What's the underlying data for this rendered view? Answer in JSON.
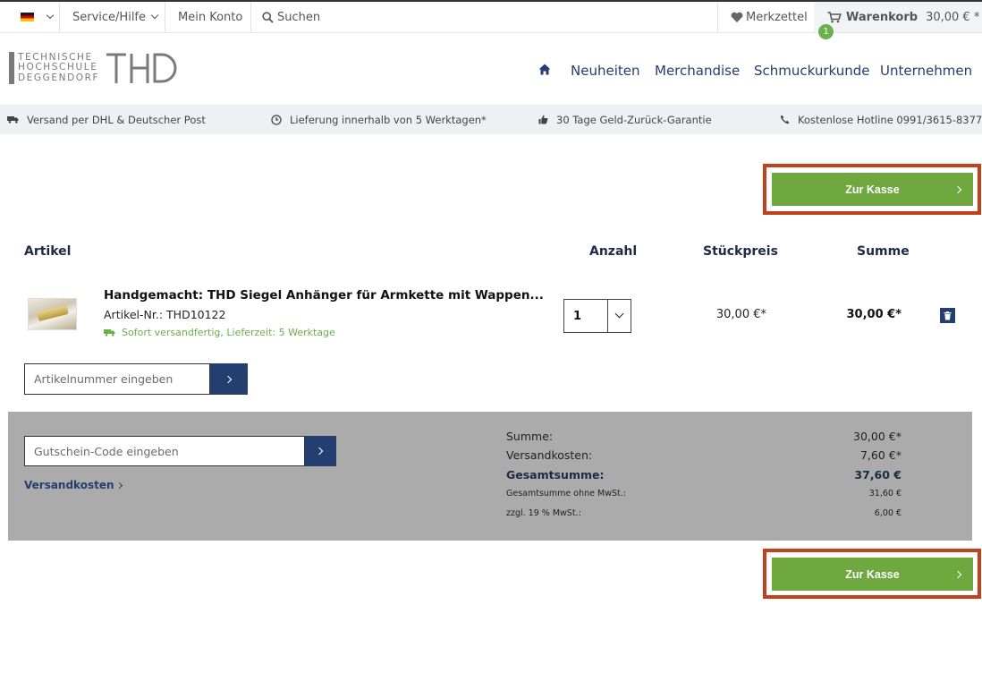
{
  "topbar": {
    "language_icon": "german-flag-icon",
    "service": "Service/Hilfe",
    "account": "Mein Konto",
    "search": "Suchen",
    "wishlist": "Merkzettel",
    "cart_label": "Warenkorb",
    "cart_total": "30,00 € *",
    "cart_count": "1"
  },
  "nav": {
    "home_icon": "home-icon",
    "items": [
      "Neuheiten",
      "Merchandise",
      "Schmuckurkunde",
      "Unternehmen"
    ]
  },
  "logo": {
    "lines": [
      "TECHNISCHE",
      "HOCHSCHULE",
      "DEGGENDORF"
    ],
    "mark": "THD"
  },
  "usp": [
    {
      "icon": "truck-icon",
      "text": "Versand per DHL & Deutscher Post"
    },
    {
      "icon": "clock-icon",
      "text": "Lieferung innerhalb von 5 Werktagen*"
    },
    {
      "icon": "thumbs-up-icon",
      "text": "30 Tage Geld-Zurück-Garantie"
    },
    {
      "icon": "phone-icon",
      "text": "Kostenlose Hotline 0991/3615-8377"
    }
  ],
  "checkout": {
    "label": "Zur Kasse"
  },
  "table": {
    "headers": {
      "article": "Artikel",
      "quantity": "Anzahl",
      "unit_price": "Stückpreis",
      "sum": "Summe"
    }
  },
  "item": {
    "name": "Handgemacht: THD Siegel Anhänger für Armkette mit Wappen...",
    "number": "Artikel-Nr.: THD10122",
    "shipping": "Sofort versandfertig, Lieferzeit: 5 Werktage",
    "quantity": "1",
    "unit_price": "30,00 €*",
    "sum": "30,00 €*"
  },
  "add_article": {
    "placeholder": "Artikelnummer eingeben"
  },
  "voucher": {
    "placeholder": "Gutschein-Code eingeben"
  },
  "shipping_link": "Versandkosten",
  "totals": {
    "sum_label": "Summe:",
    "sum": "30,00 €*",
    "shipping_label": "Versandkosten:",
    "shipping": "7,60 €*",
    "grand_label": "Gesamtsumme:",
    "grand": "37,60 €",
    "net_label": "Gesamtsumme ohne MwSt.:",
    "net": "31,60 €",
    "vat_label": "zzgl. 19 % MwSt.:",
    "vat": "6,00 €"
  },
  "colors": {
    "primary": "#233e6f",
    "success": "#6fa83f",
    "highlight": "#c2401c",
    "panel": "#ababab"
  }
}
